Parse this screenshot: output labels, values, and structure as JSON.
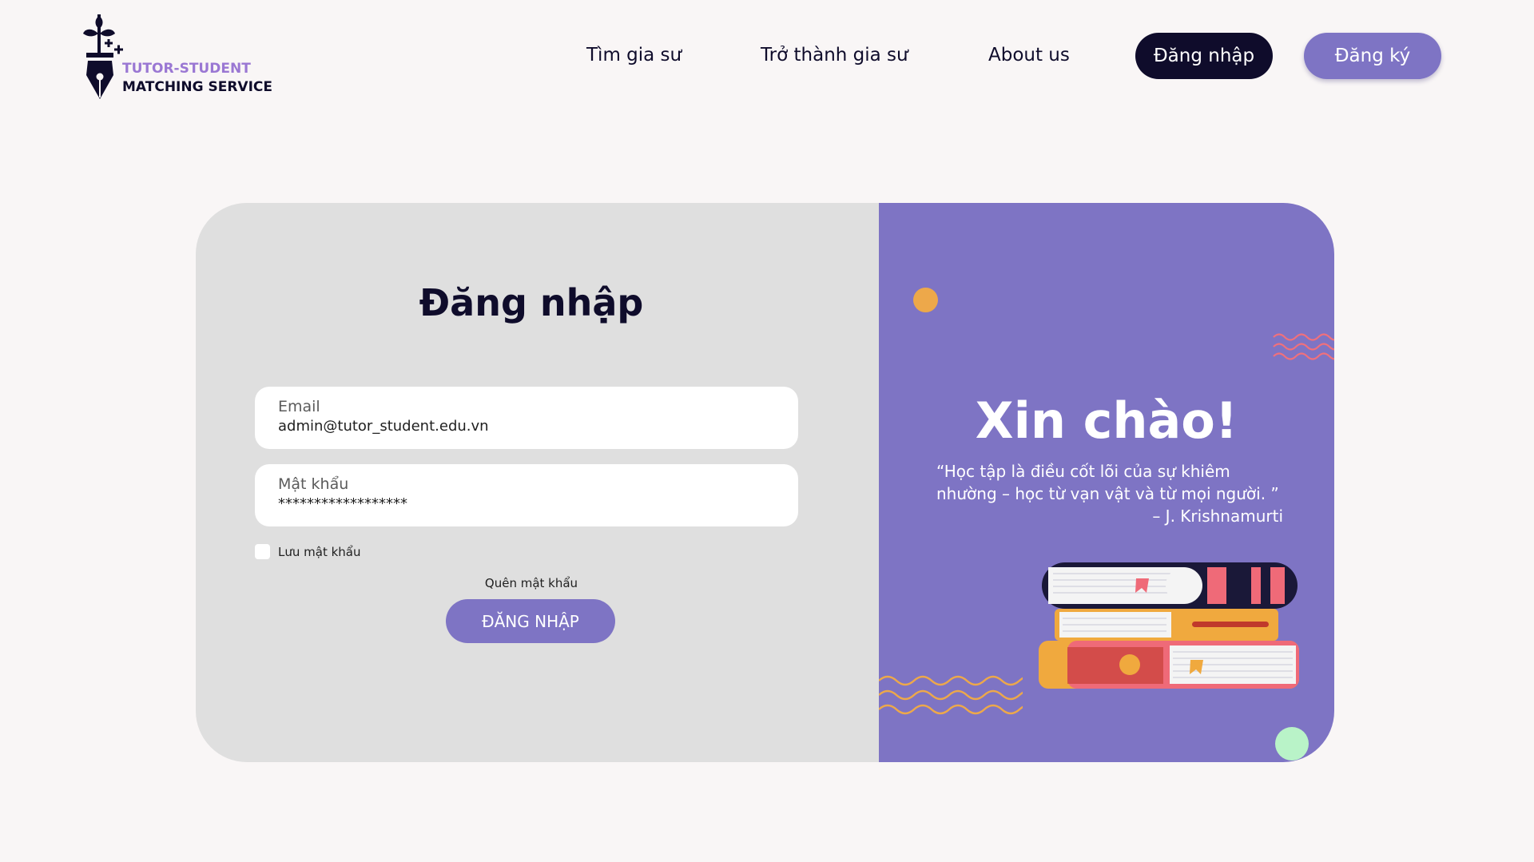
{
  "brand": {
    "line1": "TUTOR-STUDENT",
    "line2": "MATCHING SERVICE"
  },
  "nav": {
    "find_tutor": "Tìm gia sư",
    "become_tutor": "Trở thành gia sư",
    "about": "About us",
    "login": "Đăng nhập",
    "register": "Đăng ký"
  },
  "login_form": {
    "title": "Đăng nhập",
    "email_label": "Email",
    "email_value": "admin@tutor_student.edu.vn",
    "password_label": "Mật khẩu",
    "password_value": "******************",
    "remember_label": "Lưu mật khẩu",
    "remember_checked": false,
    "forgot_label": "Quên mật khẩu",
    "submit_label": "ĐĂNG NHẬP"
  },
  "welcome": {
    "greeting": "Xin chào!",
    "quote": "“Học tập là điều cốt lõi của sự khiêm nhường – học từ vạn vật và từ mọi người. ”",
    "author": "– J. Krishnamurti"
  },
  "colors": {
    "background": "#f9f6f6",
    "dark": "#0f0c2b",
    "accent": "#7e74c4",
    "logo_purple": "#9a77d3",
    "form_panel": "#dfdfdf",
    "dot_orange": "#eda84a",
    "dot_green": "#b9f3c8"
  },
  "icons": {
    "logo": "fountain-pen-plant-icon",
    "decor": [
      "books-stack-icon",
      "wave-red-icon",
      "wave-yellow-icon"
    ]
  }
}
